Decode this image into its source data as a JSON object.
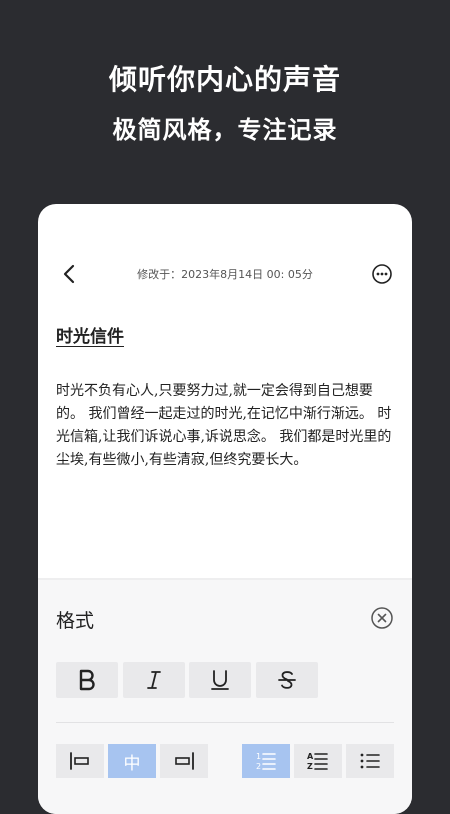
{
  "promo": {
    "title": "倾听你内心的声音",
    "subtitle": "极简风格，专注记录"
  },
  "editor": {
    "modified": "修改于：2023年8月14日 00: 05分",
    "note_title": "时光信件",
    "note_body": "时光不负有心人,只要努力过,就一定会得到自己想要的。 我们曾经一起走过的时光,在记忆中渐行渐远。 时光信箱,让我们诉说心事,诉说思念。 我们都是时光里的尘埃,有些微小,有些清寂,但终究要长大。"
  },
  "format_panel": {
    "title": "格式",
    "text_styles": [
      {
        "name": "bold",
        "icon": "bold-icon"
      },
      {
        "name": "italic",
        "icon": "italic-icon"
      },
      {
        "name": "underline",
        "icon": "underline-icon"
      },
      {
        "name": "strikethrough",
        "icon": "strikethrough-icon"
      }
    ],
    "align_center_label": "中",
    "active_align": "center",
    "active_list": "numbered"
  },
  "colors": {
    "background": "#2b2c30",
    "accent": "#a7c4f0",
    "button_bg": "#e9e9eb"
  }
}
